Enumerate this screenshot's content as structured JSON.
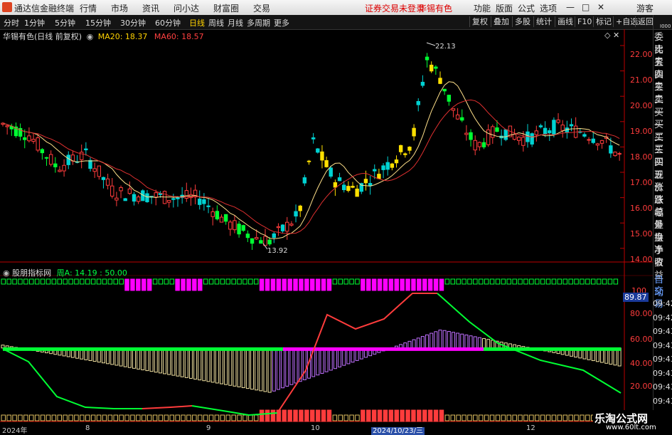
{
  "menubar": {
    "app_title": "通达信金融终端",
    "items": [
      "行情",
      "市场",
      "资讯",
      "问小达",
      "财富圈",
      "交易"
    ],
    "notice": "证券交易未登录",
    "stock": "华锡有色",
    "right_items": [
      "功能",
      "版面",
      "公式",
      "选项"
    ],
    "guest": "游客",
    "controls": [
      "—",
      "□",
      "✕"
    ]
  },
  "toolbar": {
    "periods": [
      "分时",
      "1分钟",
      "5分钟",
      "15分钟",
      "30分钟",
      "60分钟",
      "日线",
      "周线",
      "月线",
      "多周期",
      "更多"
    ],
    "active": "日线",
    "right_buttons": [
      "复权",
      "叠加",
      "多股",
      "统计",
      "画线",
      "F10",
      "标记",
      "+自选",
      "返回"
    ]
  },
  "price_panel": {
    "title": "华锡有色(日线 前复权)",
    "ma20": "MA20: 18.37",
    "ma60": "MA60: 18.57",
    "high_label": "22.13",
    "low_label": "13.92",
    "y_ticks": [
      "22.00",
      "21.00",
      "20.00",
      "19.00",
      "18.00",
      "17.00",
      "16.00",
      "15.00",
      "14.00"
    ]
  },
  "indicator_panel": {
    "title": "股朋指标网",
    "value": "周A: 14.19 : 50.00",
    "current_value": "89.87",
    "y_ticks": [
      "100",
      "80.00",
      "60.00",
      "40.00",
      "20.00"
    ]
  },
  "right_panel": {
    "labels": [
      "委比",
      "卖五",
      "卖四",
      "卖三",
      "卖二",
      "卖一",
      "买一",
      "买二",
      "买三",
      "买四",
      "买五",
      "现价",
      "涨跌",
      "涨幅",
      "总量",
      "外盘",
      "换手",
      "净资",
      "收益"
    ],
    "auto": "自动",
    "trade": "交易",
    "times": [
      "09:42",
      "09:42",
      "09:43",
      "09:43",
      "09:43",
      "09:43",
      "09:43",
      "09:43",
      "09:43"
    ]
  },
  "bottom_axis": [
    "2024年",
    "8",
    "9",
    "10",
    "2024/10/23/三",
    "12"
  ],
  "watermark": {
    "line1": "乐淘公式网",
    "line2": "www.60lt.com"
  },
  "colors": {
    "up": "#ff3c3c",
    "down": "#00d2d2",
    "strong_up": "#ffe000",
    "strong_down": "#00ff33",
    "magenta": "#ff00ff"
  }
}
